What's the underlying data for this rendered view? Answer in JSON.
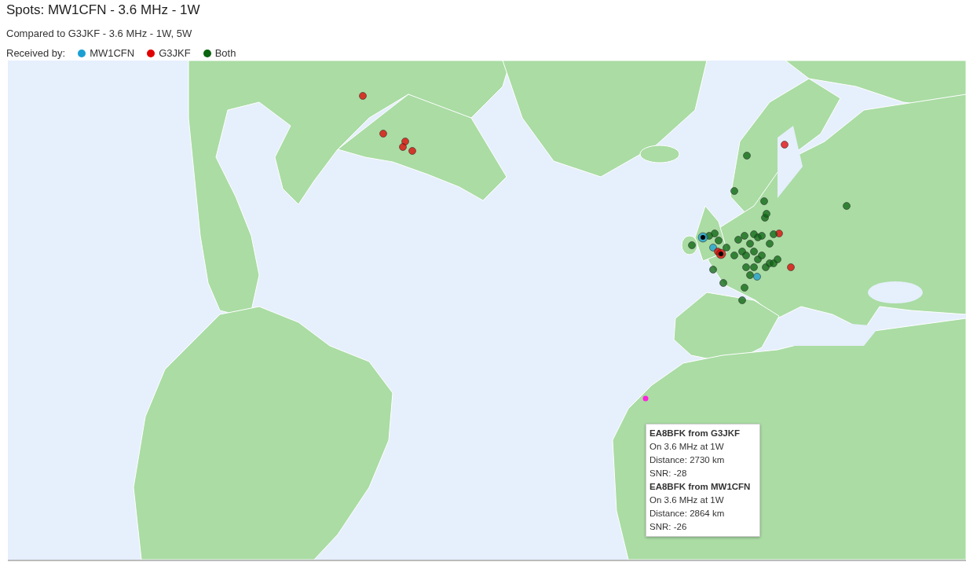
{
  "title": "Spots: MW1CFN - 3.6 MHz - 1W",
  "subtitle": "Compared to G3JKF - 3.6 MHz - 1W, 5W",
  "legend": {
    "label": "Received by:",
    "items": [
      {
        "label": "MW1CFN",
        "color": "#1a9fd4"
      },
      {
        "label": "G3JKF",
        "color": "#e00000"
      },
      {
        "label": "Both",
        "color": "#0a6410"
      }
    ]
  },
  "tooltip": {
    "entries": [
      {
        "heading": "EA8BFK from G3JKF",
        "lines": [
          "On 3.6 MHz at 1W",
          "Distance: 2730 km",
          "SNR: -28"
        ]
      },
      {
        "heading": "EA8BFK from MW1CFN",
        "lines": [
          "On 3.6 MHz at 1W",
          "Distance: 2864 km",
          "SNR: -26"
        ]
      }
    ]
  }
}
